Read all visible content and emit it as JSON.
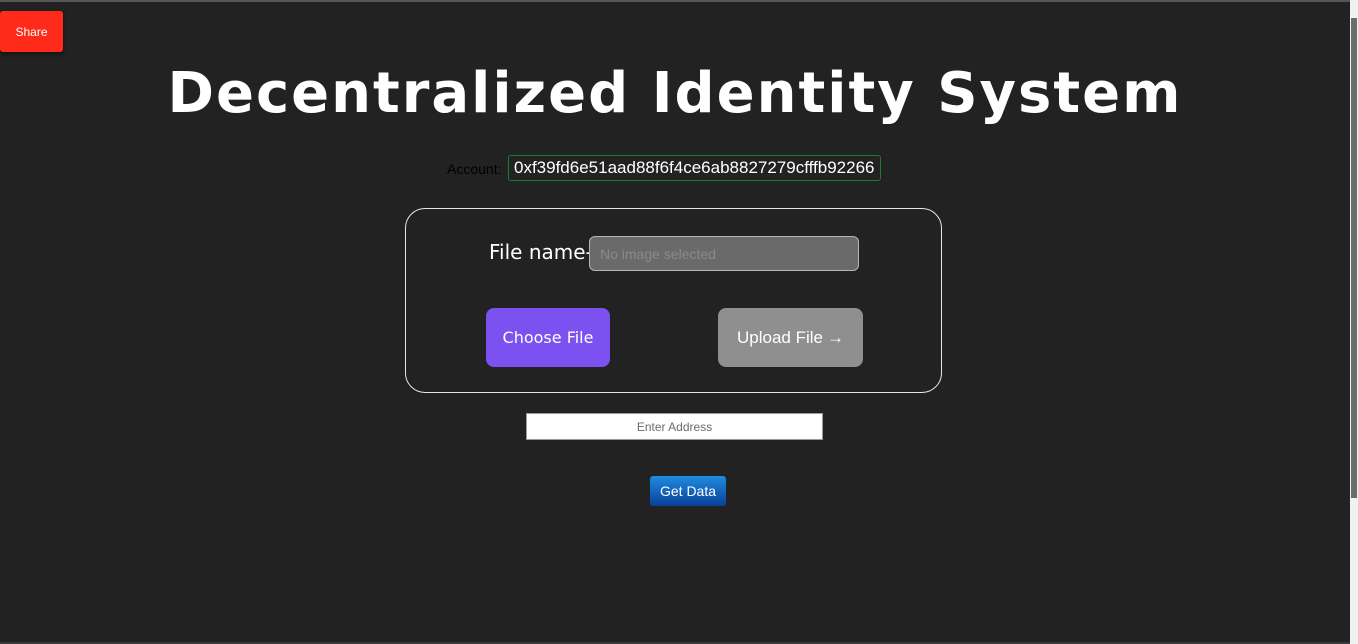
{
  "share": {
    "label": "Share"
  },
  "header": {
    "title": "Decentralized Identity System"
  },
  "account": {
    "label": "Account:",
    "address": "0xf39fd6e51aad88f6f4ce6ab8827279cfffb92266"
  },
  "upload": {
    "file_name_label": "File name-",
    "file_name_placeholder": "No image selected",
    "choose_file_label": "Choose File",
    "upload_file_label": "Upload File",
    "upload_arrow": "→"
  },
  "lookup": {
    "address_placeholder": "Enter Address",
    "get_data_label": "Get Data"
  },
  "colors": {
    "background": "#222222",
    "share": "#ff2a1a",
    "choose_file": "#7b52f0",
    "upload_file": "#8f8f8f",
    "get_data": "#0b3f98",
    "account_border": "#1f7a2e"
  }
}
